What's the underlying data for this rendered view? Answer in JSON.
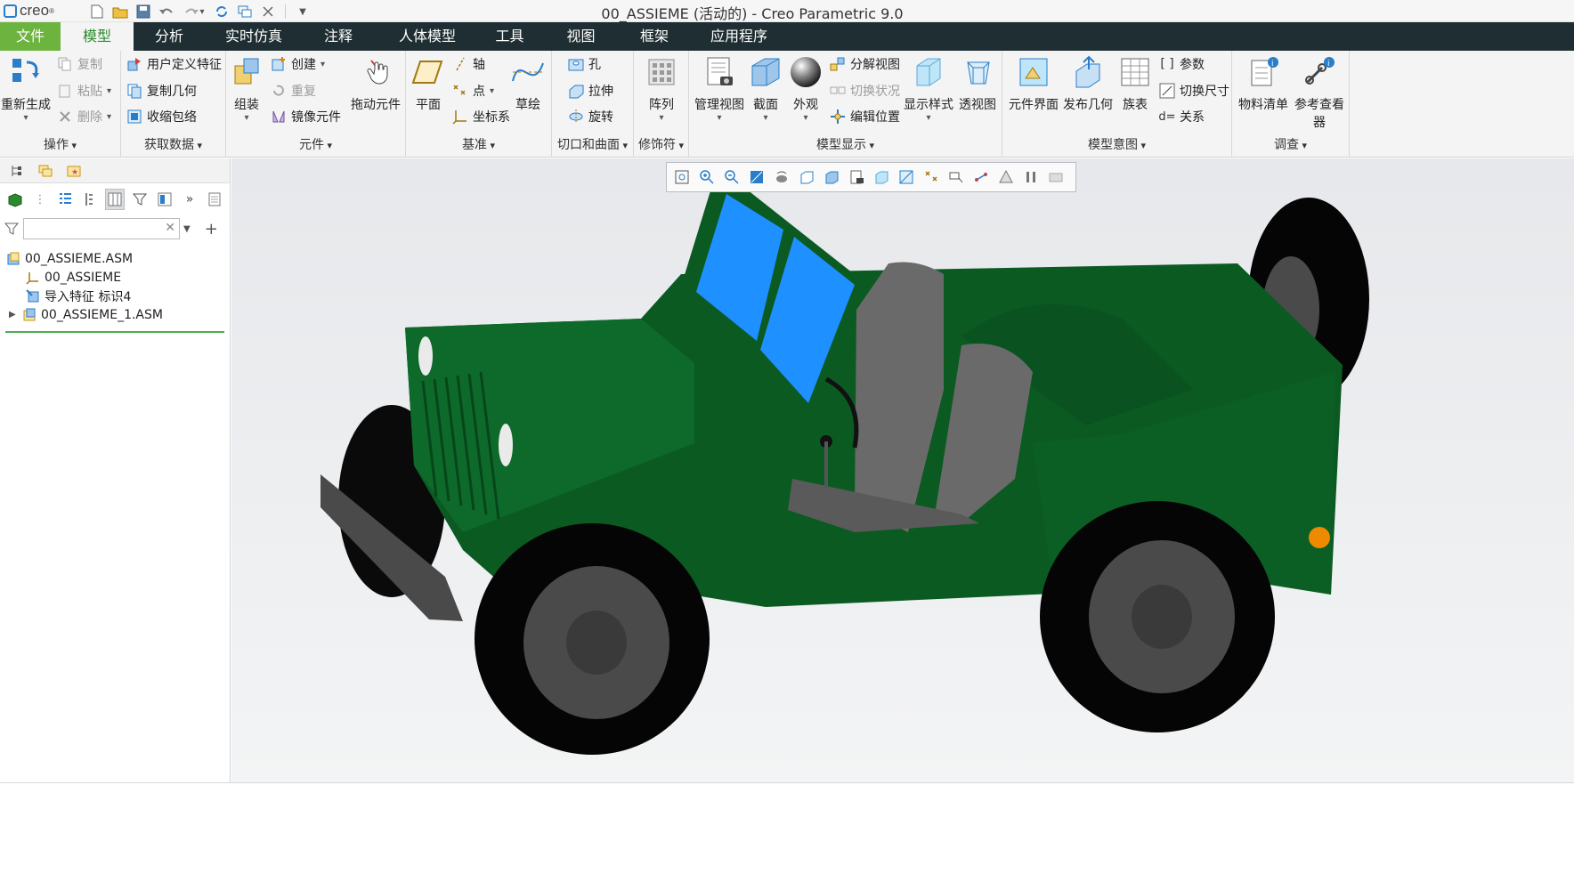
{
  "app": {
    "logo_text": "creo",
    "window_title": "00_ASSIEME (活动的) - Creo Parametric 9.0"
  },
  "quick_access": [
    "new-icon",
    "open-icon",
    "save-icon",
    "undo-icon",
    "redo-icon",
    "regenerate-icon",
    "windows-icon",
    "close-window-icon",
    "customize-icon"
  ],
  "tabs": [
    {
      "label": "文件",
      "kind": "file"
    },
    {
      "label": "模型",
      "kind": "active"
    },
    {
      "label": "分析"
    },
    {
      "label": "实时仿真"
    },
    {
      "label": "注释"
    },
    {
      "label": "人体模型"
    },
    {
      "label": "工具"
    },
    {
      "label": "视图"
    },
    {
      "label": "框架"
    },
    {
      "label": "应用程序"
    }
  ],
  "ribbon": {
    "operations": {
      "group": "操作",
      "regenerate": "重新生成",
      "copy": "复制",
      "paste": "粘贴",
      "delete": "删除"
    },
    "get_data": {
      "group": "获取数据",
      "udf": "用户定义特征",
      "copy_geom": "复制几何",
      "shrinkwrap": "收缩包络"
    },
    "components": {
      "group": "元件",
      "assemble": "组装",
      "create": "创建",
      "repeat": "重复",
      "mirror": "镜像元件",
      "drag": "拖动元件"
    },
    "datum": {
      "group": "基准",
      "plane": "平面",
      "axis": "轴",
      "point": "点",
      "csys": "坐标系",
      "sketch": "草绘"
    },
    "cut_surface": {
      "group": "切口和曲面",
      "hole": "孔",
      "extrude": "拉伸",
      "revolve": "旋转"
    },
    "modifiers": {
      "group": "修饰符",
      "pattern": "阵列"
    },
    "model_display": {
      "group": "模型显示",
      "manage_views": "管理视图",
      "section": "截面",
      "appearance": "外观",
      "explode": "分解视图",
      "toggle_status": "切换状况",
      "edit_position": "编辑位置",
      "display_style": "显示样式",
      "perspective": "透视图"
    },
    "model_intent": {
      "group": "模型意图",
      "comp_interface": "元件界面",
      "publish_geom": "发布几何",
      "family_table": "族表",
      "params": "参数",
      "switch_dims": "切换尺寸",
      "relations": "关系"
    },
    "investigate": {
      "group": "调查",
      "bom": "物料清单",
      "ref_viewer": "参考查看器"
    }
  },
  "model_tree": {
    "search_placeholder": "",
    "items": [
      {
        "label": "00_ASSIEME.ASM",
        "icon": "assembly-icon",
        "level": 0
      },
      {
        "label": "00_ASSIEME",
        "icon": "csys-icon",
        "level": 1
      },
      {
        "label": "导入特征 标识4",
        "icon": "import-feature-icon",
        "level": 1
      },
      {
        "label": "00_ASSIEME_1.ASM",
        "icon": "subassembly-icon",
        "level": 1,
        "expandable": true
      }
    ]
  },
  "graphics_toolbar": [
    "refit-icon",
    "zoom-in-icon",
    "zoom-out-icon",
    "repaint-icon",
    "spin-center-icon",
    "view-orient-icon",
    "saved-orientations-icon",
    "view-manager-icon",
    "display-style-icon",
    "section-icon",
    "datum-display-icon",
    "annotation-display-icon",
    "spin-icon",
    "appearance-icon",
    "pause-icon",
    "display-settings-icon"
  ],
  "colors": {
    "body_green": "#0b5a22",
    "glass": "#1e90ff",
    "seat": "#6a6a6a",
    "tire": "#050505",
    "file_tab": "#6db33f",
    "tab_bar": "#1f2e32"
  }
}
